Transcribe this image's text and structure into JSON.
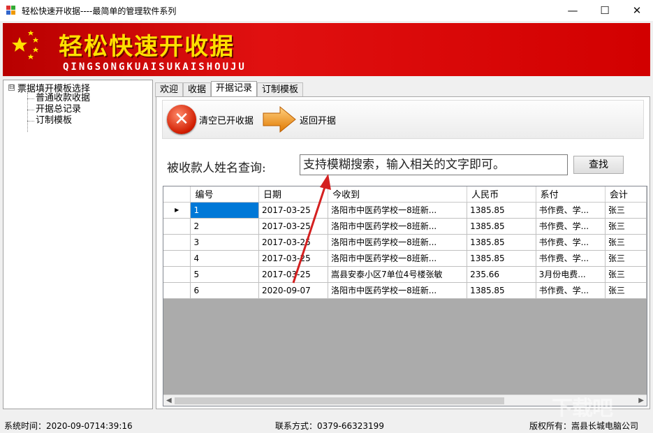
{
  "window": {
    "title": "轻松快速开收据----最简单的管理软件系列",
    "minimize": "—",
    "maximize": "☐",
    "close": "✕"
  },
  "banner": {
    "title": "轻松快速开收据",
    "subtitle": "QINGSONGKUAISUKAISHOUJU"
  },
  "tree": {
    "root_toggle": "⊟",
    "root": "票据填开模板选择",
    "children": [
      "普通收款收据",
      "开据总记录",
      "订制模板"
    ]
  },
  "tabs": [
    {
      "label": "欢迎"
    },
    {
      "label": "收据"
    },
    {
      "label": "开据记录"
    },
    {
      "label": "订制模板"
    }
  ],
  "toolbar": {
    "clear_label": "清空已开收据",
    "back_label": "返回开据"
  },
  "search": {
    "label": "被收款人姓名查询:",
    "placeholder": "支持模糊搜索，输入相关的文字即可。",
    "button": "查找"
  },
  "grid": {
    "columns": [
      "编号",
      "日期",
      "今收到",
      "人民币",
      "系付",
      "会计"
    ],
    "current_row_marker": "▶",
    "rows": [
      [
        "1",
        "2017-03-25",
        "洛阳市中医药学校一8班新...",
        "1385.85",
        "书作费、学...",
        "张三"
      ],
      [
        "2",
        "2017-03-25",
        "洛阳市中医药学校一8班新...",
        "1385.85",
        "书作费、学...",
        "张三"
      ],
      [
        "3",
        "2017-03-25",
        "洛阳市中医药学校一8班新...",
        "1385.85",
        "书作费、学...",
        "张三"
      ],
      [
        "4",
        "2017-03-25",
        "洛阳市中医药学校一8班新...",
        "1385.85",
        "书作费、学...",
        "张三"
      ],
      [
        "5",
        "2017-03-25",
        "嵩县安泰小区7单位4号楼张敏",
        "235.66",
        "3月份电费...",
        "张三"
      ],
      [
        "6",
        "2020-09-07",
        "洛阳市中医药学校一8班新...",
        "1385.85",
        "书作费、学...",
        "张三"
      ]
    ]
  },
  "statusbar": {
    "time": "系统时间：2020-09-0714:39:16",
    "contact": "联系方式：0379-66323199",
    "copyright": "版权所有：嵩县长城电脑公司"
  },
  "watermark": "下载吧",
  "colors": {
    "banner_red": "#d20000",
    "banner_title": "#ffe000",
    "selection": "#0078d7",
    "annotation_arrow": "#d42020"
  }
}
